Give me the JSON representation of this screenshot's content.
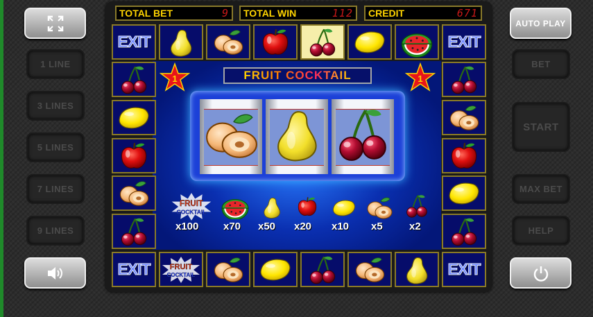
{
  "meters": {
    "total_bet_label": "TOTAL BET",
    "total_bet_value": "9",
    "total_win_label": "TOTAL WIN",
    "total_win_value": "112",
    "credit_label": "CREDIT",
    "credit_value": "671"
  },
  "left_buttons": {
    "fullscreen_icon": "fullscreen-icon",
    "line1": "1 LINE",
    "line3": "3 LINES",
    "line5": "5 LINES",
    "line7": "7 LINES",
    "line9": "9 LINES",
    "sound_icon": "speaker-icon"
  },
  "right_buttons": {
    "auto_play": "AUTO PLAY",
    "bet": "BET",
    "start": "START",
    "max_bet": "MAX BET",
    "help": "HELP",
    "power_icon": "power-icon"
  },
  "border_cells": {
    "exit": "EXIT",
    "top": [
      "EXIT",
      "pear",
      "apricot",
      "apple",
      "cherry",
      "lemon",
      "watermelon",
      "EXIT"
    ],
    "left": [
      "cherry",
      "lemon",
      "apple",
      "apricot",
      "cherry"
    ],
    "right": [
      "cherry",
      "apricot",
      "apple",
      "lemon",
      "cherry"
    ],
    "bottom": [
      "EXIT",
      "fruit-cocktail-logo",
      "apricot",
      "lemon",
      "cherry",
      "apricot",
      "pear",
      "EXIT"
    ]
  },
  "game_title": "FRUIT COCKTAIL",
  "stars": {
    "left": "1",
    "right": "1"
  },
  "reels": [
    "apricot",
    "pear",
    "cherry"
  ],
  "logo_text": {
    "line1": "FRUIT",
    "line2": "COCKTAIL"
  },
  "paytable": [
    {
      "symbol": "fruit-cocktail-logo",
      "multiplier": "x100"
    },
    {
      "symbol": "watermelon",
      "multiplier": "x70"
    },
    {
      "symbol": "pear",
      "multiplier": "x50"
    },
    {
      "symbol": "apple",
      "multiplier": "x20"
    },
    {
      "symbol": "lemon",
      "multiplier": "x10"
    },
    {
      "symbol": "apricot",
      "multiplier": "x5"
    },
    {
      "symbol": "cherry",
      "multiplier": "x2"
    }
  ],
  "colors": {
    "meter_label": "#ffd400",
    "meter_value": "#c81818",
    "cell_bg": "#060c6a",
    "highlight_cell": "#f6eeaa"
  }
}
